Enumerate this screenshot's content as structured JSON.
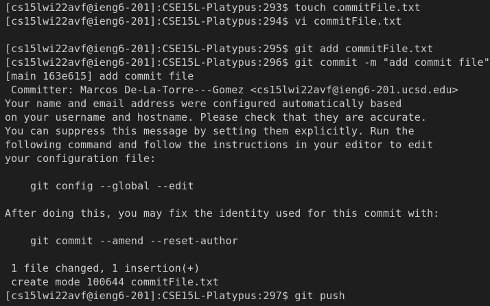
{
  "terminal": {
    "lines": [
      "[cs15lwi22avf@ieng6-201]:CSE15L-Platypus:293$ touch commitFile.txt",
      "[cs15lwi22avf@ieng6-201]:CSE15L-Platypus:294$ vi commitFile.txt",
      "",
      "[cs15lwi22avf@ieng6-201]:CSE15L-Platypus:295$ git add commitFile.txt",
      "[cs15lwi22avf@ieng6-201]:CSE15L-Platypus:296$ git commit -m \"add commit file\"",
      "[main 163e615] add commit file",
      "Committer: Marcos De-La-Torre---Gomez <cs15lwi22avf@ieng6-201.ucsd.edu>",
      "Your name and email address were configured automatically based",
      "on your username and hostname. Please check that they are accurate.",
      "You can suppress this message by setting them explicitly. Run the",
      "following command and follow the instructions in your editor to edit",
      "your configuration file:",
      "",
      "git config --global --edit",
      "",
      "After doing this, you may fix the identity used for this commit with:",
      "",
      "git commit --amend --reset-author",
      "",
      "1 file changed, 1 insertion(+)",
      "create mode 100644 commitFile.txt",
      "[cs15lwi22avf@ieng6-201]:CSE15L-Platypus:297$ git push"
    ]
  },
  "colors": {
    "background": "#1e1e1e",
    "foreground": "#cccccc"
  }
}
